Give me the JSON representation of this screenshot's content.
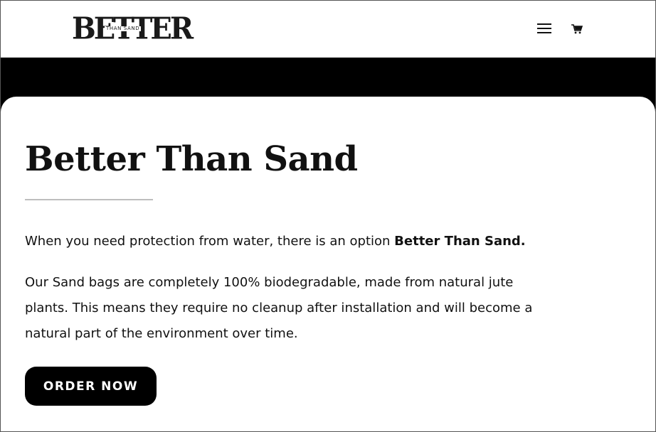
{
  "header": {
    "logo": {
      "main_text": "BETTER",
      "overlay_text": "THAN SAND"
    },
    "menu_icon": "hamburger-menu-icon",
    "cart_icon": "shopping-cart-icon"
  },
  "main": {
    "title": "Better Than Sand",
    "paragraph1": {
      "text": "When you need protection from water, there is an option ",
      "bold_text": "Better Than Sand."
    },
    "paragraph2": "Our Sand bags are completely 100% biodegradable, made from natural jute plants. This means they require no cleanup after installation and will become a natural part of the environment over time.",
    "cta_label": "ORDER NOW"
  },
  "colors": {
    "background": "#ffffff",
    "band": "#000000",
    "text": "#111111",
    "button_bg": "#000000",
    "button_text": "#ffffff",
    "divider": "#bdbdbd"
  }
}
